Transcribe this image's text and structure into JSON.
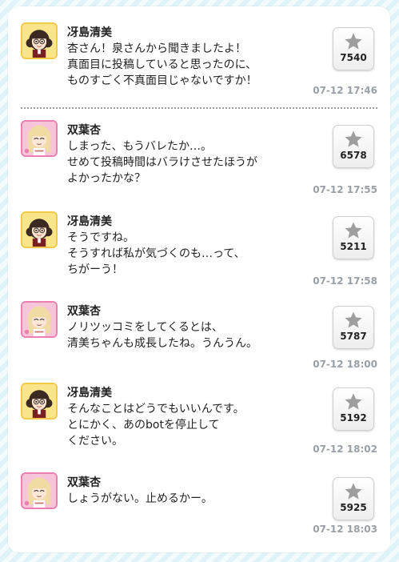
{
  "posts": [
    {
      "author": "冴島清美",
      "lines": [
        "杏さん！泉さんから聞きましたよ！",
        "真面目に投稿していると思ったのに、",
        "ものすごく不真面目じゃないですか！"
      ],
      "likes": "7540",
      "time": "07-12 17:46"
    },
    {
      "author": "双葉杏",
      "lines": [
        "しまった、もうバレたか…。",
        "せめて投稿時間はバラけさせたほうが",
        "よかったかな？"
      ],
      "likes": "6578",
      "time": "07-12 17:55"
    },
    {
      "author": "冴島清美",
      "lines": [
        "そうですね。",
        "そうすれば私が気づくのも…って、",
        "ちがーう！"
      ],
      "likes": "5211",
      "time": "07-12 17:58"
    },
    {
      "author": "双葉杏",
      "lines": [
        "ノリツッコミをしてくるとは、",
        "清美ちゃんも成長したね。うんうん。"
      ],
      "likes": "5787",
      "time": "07-12 18:00"
    },
    {
      "author": "冴島清美",
      "lines": [
        "そんなことはどうでもいいんです。",
        "とにかく、あのbotを停止して",
        "ください。"
      ],
      "likes": "5192",
      "time": "07-12 18:02"
    },
    {
      "author": "双葉杏",
      "lines": [
        "しょうがない。止めるかー。"
      ],
      "likes": "5925",
      "time": "07-12 18:03"
    }
  ],
  "icons": {
    "like": "star-icon",
    "avatar_kiyomi": "kiyomi-avatar",
    "avatar_anzu": "anzu-avatar"
  },
  "colors": {
    "kiyomi_frame": "#f3c94a",
    "anzu_frame": "#ea7fb0",
    "star": "#9e9e9e",
    "timestamp": "#9aa0a6"
  }
}
